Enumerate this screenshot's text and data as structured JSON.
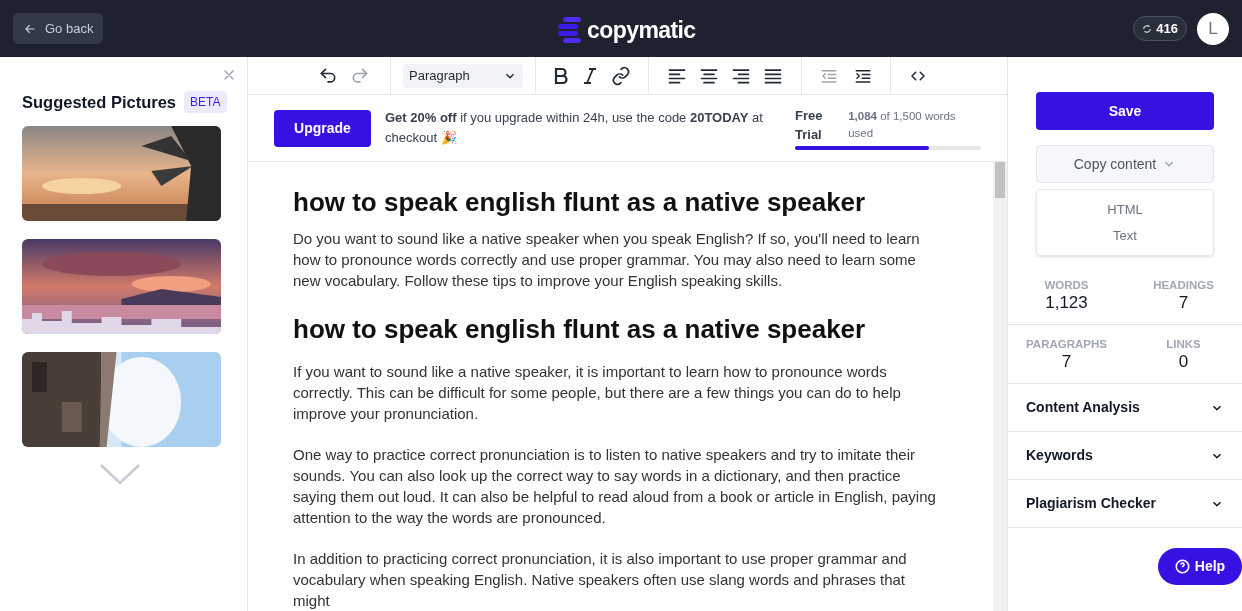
{
  "header": {
    "back_button": "Go back",
    "logo": "copymatic",
    "credits": "416",
    "avatar": "L"
  },
  "sidebar": {
    "title": "Suggested Pictures",
    "badge": "BETA"
  },
  "toolbar": {
    "block_format": "Paragraph"
  },
  "banner": {
    "button": "Upgrade",
    "message": "**Get 20% off** if you upgrade within 24h, use the code **20TODAY** at checkout 🎉",
    "plan": "Free Trial",
    "usage": "**1,084** of 1,500 words used",
    "level": 0.72
  },
  "document": {
    "blocks": [
      {
        "kind": "heading",
        "text": "how to speak english flunt as a native speaker"
      },
      {
        "kind": "paragraph",
        "text": "Do you want to sound like a native speaker when you speak English? If so, you'll need to learn how to pronounce words correctly and use proper grammar. You may also need to learn some new vocabulary. Follow these tips to improve your English speaking skills."
      },
      {
        "kind": "heading",
        "text": "how to speak english flunt as a native speaker"
      },
      {
        "kind": "paragraph",
        "text": "If you want to sound like a native speaker, it is important to learn how to pronounce words correctly. This can be difficult for some people, but there are a few things you can do to help improve your pronunciation."
      },
      {
        "kind": "paragraph",
        "text": "One way to practice correct pronunciation is to listen to native speakers and try to imitate their sounds. You can also look up the correct way to say words in a dictionary, and then practice saying them out loud. It can also be helpful to read aloud from a book or article in English, paying attention to the way the words are pronounced."
      },
      {
        "kind": "paragraph",
        "text": "In addition to practicing correct pronunciation, it is also important to use proper grammar and vocabulary when speaking English. Native speakers often use slang words and phrases that might"
      }
    ]
  },
  "right_panel": {
    "save_button": "Save",
    "copy_button": "Copy content",
    "copy_menu": [
      "HTML",
      "Text"
    ],
    "stats": [
      {
        "label": "WORDS",
        "value": "1,123"
      },
      {
        "label": "HEADINGS",
        "value": "7"
      },
      {
        "label": "PARAGRAPHS",
        "value": "7"
      },
      {
        "label": "LINKS",
        "value": "0"
      }
    ],
    "sections": [
      "Content Analysis",
      "Keywords",
      "Plagiarism Checker"
    ],
    "help_button": "Help"
  }
}
